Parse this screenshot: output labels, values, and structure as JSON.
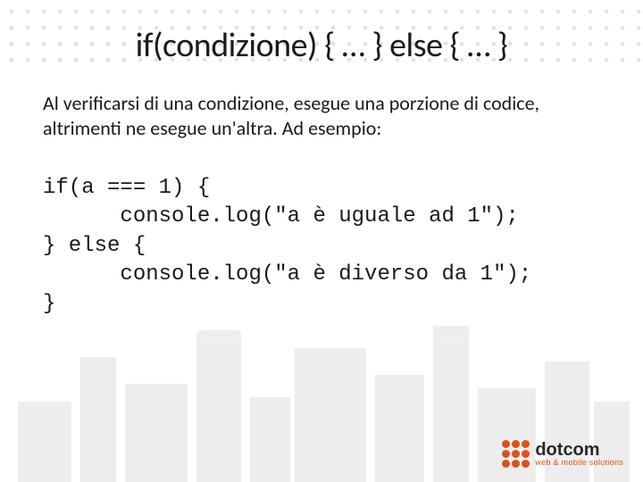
{
  "slide": {
    "title": "if(condizione) { … } else { … }",
    "description": "Al verificarsi di una condizione, esegue una porzione di codice, altrimenti ne esegue un'altra. Ad esempio:",
    "code": "if(a === 1) {\n      console.log(\"a è uguale ad 1\");\n} else {\n      console.log(\"a è diverso da 1\");\n}"
  },
  "logo": {
    "name": "dotcom",
    "tagline": "web & mobile solutions",
    "accent": "#d9531e"
  }
}
